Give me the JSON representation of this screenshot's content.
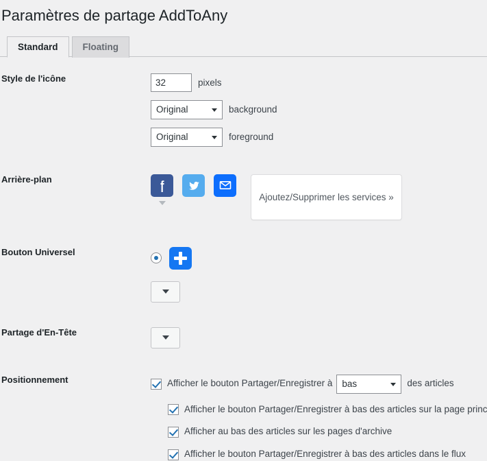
{
  "page": {
    "title": "Paramètres de partage AddToAny"
  },
  "tabs": [
    {
      "label": "Standard",
      "active": true
    },
    {
      "label": "Floating",
      "active": false
    }
  ],
  "rows": {
    "icon_style": {
      "label": "Style de l'icône",
      "size_value": "32",
      "size_placeholder": "32",
      "size_unit": "pixels",
      "background_select": "Original",
      "background_text": "background",
      "foreground_select": "Original",
      "foreground_text": "foreground"
    },
    "background": {
      "label": "Arrière-plan",
      "services": [
        {
          "name": "facebook",
          "glyph": "f",
          "color": "#3b5998",
          "has_caret": true
        },
        {
          "name": "twitter",
          "glyph": "",
          "color": "#55acee",
          "has_caret": false
        },
        {
          "name": "email",
          "glyph": "",
          "color": "#0d6efd",
          "has_caret": false
        }
      ],
      "services_button": "Ajoutez/Supprimer les services »"
    },
    "universal_button": {
      "label": "Bouton Universel",
      "radio_checked": true,
      "plus_color": "#1577f2"
    },
    "header_share": {
      "label": "Partage d'En-Tête"
    },
    "positioning": {
      "label": "Positionnement",
      "main_checkbox": {
        "checked": true,
        "text_before": "Afficher le bouton Partager/Enregistrer à",
        "select_value": "bas",
        "text_after": "des articles"
      },
      "sub_checkboxes": [
        {
          "checked": true,
          "label": "Afficher le bouton Partager/Enregistrer à bas des articles sur la page principale"
        },
        {
          "checked": true,
          "label": "Afficher au bas des articles sur les pages d'archive"
        },
        {
          "checked": true,
          "label": "Afficher le bouton Partager/Enregistrer à bas des articles dans le flux"
        }
      ]
    }
  },
  "colors": {
    "page_background": "#f0f0f1",
    "accent": "#2271b1",
    "facebook": "#3b5998",
    "twitter": "#55acee",
    "email": "#0d6efd"
  }
}
